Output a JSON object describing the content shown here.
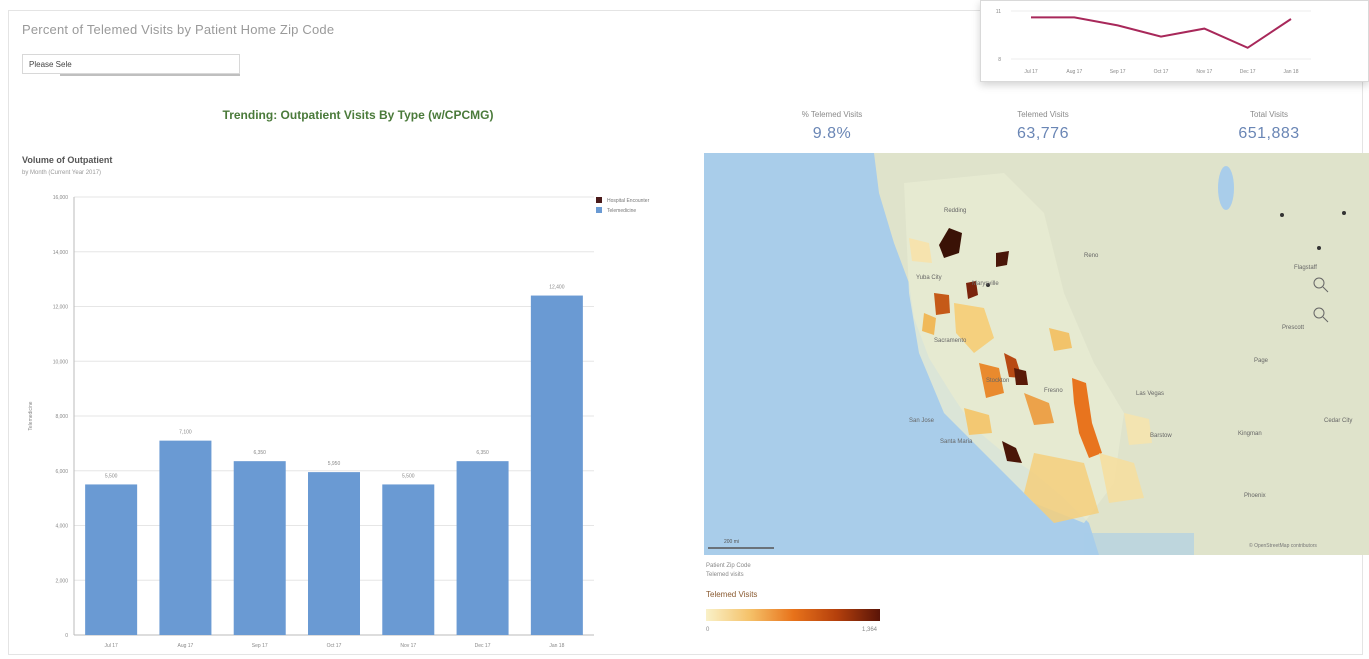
{
  "page": {
    "title": "Percent of Telemed Visits by Patient Home Zip Code",
    "filter_label": "Please Sele"
  },
  "main_chart": {
    "heading": "Trending: Outpatient Visits By Type (w/CPCMG)",
    "title": "Volume of Outpatient",
    "subtitle": "by Month (Current Year 2017)"
  },
  "kpis": [
    {
      "label": "% Telemed Visits",
      "value": "9.8%"
    },
    {
      "label": "Telemed Visits",
      "value": "63,776"
    },
    {
      "label": "Total Visits",
      "value": "651,883"
    }
  ],
  "map": {
    "scale_label": "200 mi",
    "attribution": "© OpenStreetMap contributors",
    "info_line_1": "Patient Zip Code",
    "info_line_2": "Telemed visits",
    "legend_title": "Telemed Visits",
    "legend_min": "0",
    "legend_max": "1,364",
    "place_labels": [
      "Redding",
      "Yuba City",
      "Marysville",
      "Sacramento",
      "Stockton",
      "Fresno",
      "San Jose",
      "Santa Maria",
      "Reno",
      "Las Vegas",
      "Barstow",
      "Kingman",
      "Phoenix",
      "Flagstaff",
      "Prescott",
      "Page",
      "Cedar City"
    ]
  },
  "chart_data": [
    {
      "type": "bar",
      "title": "Volume of Outpatient",
      "subtitle": "by Month (Current Year 2017)",
      "categories": [
        "Jul 17",
        "Aug 17",
        "Sep 17",
        "Oct 17",
        "Nov 17",
        "Dec 17",
        "Jan 18"
      ],
      "series": [
        {
          "name": "Hospital Encounter",
          "values": [
            0,
            0,
            0,
            0,
            0,
            0,
            0
          ],
          "color": "#4a1a1a"
        },
        {
          "name": "Telemedicine",
          "values": [
            5500,
            7100,
            6350,
            5950,
            5500,
            6350,
            12400
          ],
          "color": "#6a9ad3"
        }
      ],
      "data_labels": [
        "5,500",
        "7,100",
        "6,350",
        "5,950",
        "5,500",
        "6,350",
        "12,400"
      ],
      "ylabel": "Telemedicine",
      "ylim": [
        0,
        12000
      ],
      "yticks": [
        0,
        2000,
        4000,
        6000,
        8000,
        10000,
        12000,
        14000,
        16000
      ],
      "ytick_labels": [
        "0",
        "2,000",
        "4,000",
        "6,000",
        "8,000",
        "10,000",
        "12,000",
        "14,000",
        "16,000"
      ],
      "grid": true,
      "legend": "top-right"
    },
    {
      "type": "line",
      "categories": [
        "Jul 17",
        "Aug 17",
        "Sep 17",
        "Oct 17",
        "Nov 17",
        "Dec 17",
        "Jan 18"
      ],
      "series": [
        {
          "values": [
            10.6,
            10.6,
            10.1,
            9.4,
            9.9,
            8.7,
            10.5
          ],
          "color": "#a8285a"
        }
      ],
      "ylim": [
        8,
        11
      ],
      "ytick_labels": [
        "8",
        "",
        "11"
      ],
      "grid": true
    }
  ]
}
